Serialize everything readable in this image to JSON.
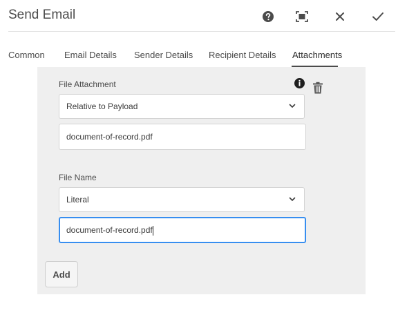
{
  "dialog": {
    "title": "Send Email",
    "actions": {
      "help_icon": "help-icon",
      "fullscreen_icon": "fullscreen-icon",
      "close_icon": "close-icon",
      "confirm_icon": "checkmark-icon"
    }
  },
  "tabs": [
    {
      "label": "Common",
      "active": false
    },
    {
      "label": "Email Details",
      "active": false
    },
    {
      "label": "Sender Details",
      "active": false
    },
    {
      "label": "Recipient Details",
      "active": false
    },
    {
      "label": "Attachments",
      "active": true
    }
  ],
  "attachment": {
    "file_attachment_label": "File Attachment",
    "file_attachment_mode": "Relative to Payload",
    "file_attachment_value": "document-of-record.pdf",
    "file_name_label": "File Name",
    "file_name_mode": "Literal",
    "file_name_value": "document-of-record.pdf",
    "info_icon": "info-icon",
    "delete_icon": "trash-icon"
  },
  "add_button": "Add",
  "colors": {
    "panel_bg": "#efefef",
    "focus_border": "#378ef0",
    "text": "#4b4b4b"
  }
}
